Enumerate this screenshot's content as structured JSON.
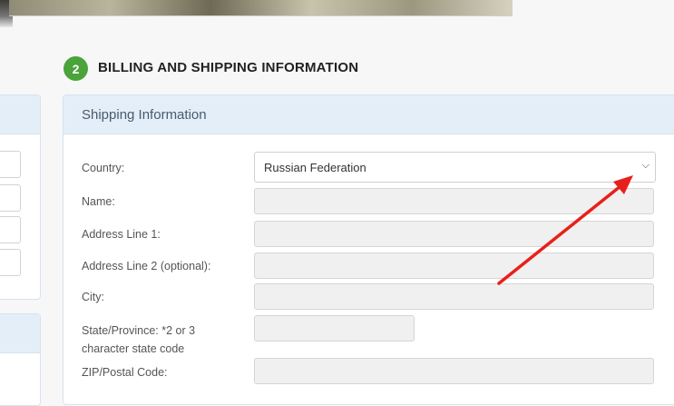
{
  "step": {
    "number": "2",
    "title": "BILLING AND SHIPPING INFORMATION"
  },
  "shipping": {
    "header": "Shipping Information",
    "fields": {
      "country_label": "Country:",
      "country_value": "Russian Federation",
      "name_label": "Name:",
      "address1_label": "Address Line 1:",
      "address2_label": "Address Line 2 (optional):",
      "city_label": "City:",
      "state_label_line1": "State/Province: *2 or 3",
      "state_label_line2": "character state code",
      "zip_label": "ZIP/Postal Code:"
    }
  },
  "annotation": {
    "arrow_color": "#e8201a"
  },
  "colors": {
    "badge_green": "#4aa33b",
    "panel_header_bg": "#e3eef8"
  }
}
